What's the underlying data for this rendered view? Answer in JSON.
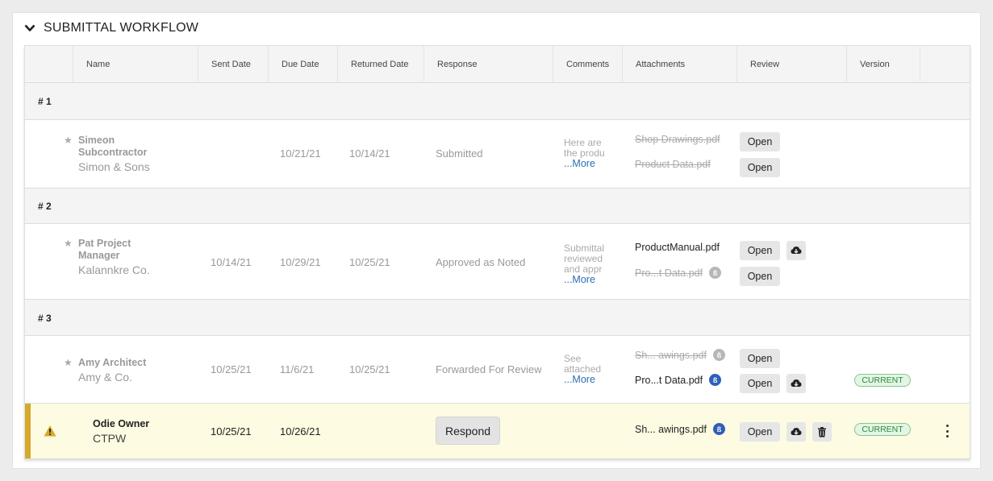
{
  "section": {
    "title": "SUBMITTAL WORKFLOW"
  },
  "columns": [
    "Name",
    "Sent Date",
    "Due Date",
    "Returned Date",
    "Response",
    "Comments",
    "Attachments",
    "Review",
    "Version"
  ],
  "groups": [
    {
      "label": "# 1",
      "rows": [
        {
          "name": "Simeon Subcontractor",
          "company": "Simon & Sons",
          "sent": "",
          "due": "10/21/21",
          "returned": "10/14/21",
          "response": "Submitted",
          "comment": "Here are the produ",
          "more": "...More",
          "attachments": [
            "Shop Drawings.pdf",
            "Product Data.pdf"
          ],
          "open_label": "Open"
        }
      ]
    },
    {
      "label": "# 2",
      "rows": [
        {
          "name": "Pat Project Manager",
          "company": "Kalannkre Co.",
          "sent": "10/14/21",
          "due": "10/29/21",
          "returned": "10/25/21",
          "response": "Approved as Noted",
          "comment": "Submittal reviewed and appr",
          "more": "...More",
          "attachments": [
            "ProductManual.pdf",
            "Pro...t Data.pdf"
          ],
          "open_label": "Open"
        }
      ]
    },
    {
      "label": "# 3",
      "rows": [
        {
          "name": "Amy Architect",
          "company": "Amy & Co.",
          "sent": "10/25/21",
          "due": "11/6/21",
          "returned": "10/25/21",
          "response": "Forwarded For Review",
          "comment": "See attached for y",
          "more": "...More",
          "attachments": [
            "Sh... awings.pdf",
            "Pro...t Data.pdf"
          ],
          "open_label": "Open",
          "version": "CURRENT"
        },
        {
          "name": "Odie Owner",
          "company": "CTPW",
          "sent": "10/25/21",
          "due": "10/26/21",
          "returned": "",
          "response_button": "Respond",
          "attachments": [
            "Sh... awings.pdf"
          ],
          "open_label": "Open",
          "version": "CURRENT"
        }
      ]
    }
  ],
  "icons": {
    "collapse": "chevron-down-icon",
    "star": "star-icon",
    "download": "cloud-download-icon",
    "delete": "trash-icon",
    "warning": "warning-icon",
    "more": "more-vertical-icon",
    "markup": "bluebeam-icon"
  },
  "colors": {
    "accent_bar": "#d6a92c",
    "link": "#2a6db5",
    "current_badge": "#2b8a3a",
    "markup_active": "#2f5fb8"
  }
}
